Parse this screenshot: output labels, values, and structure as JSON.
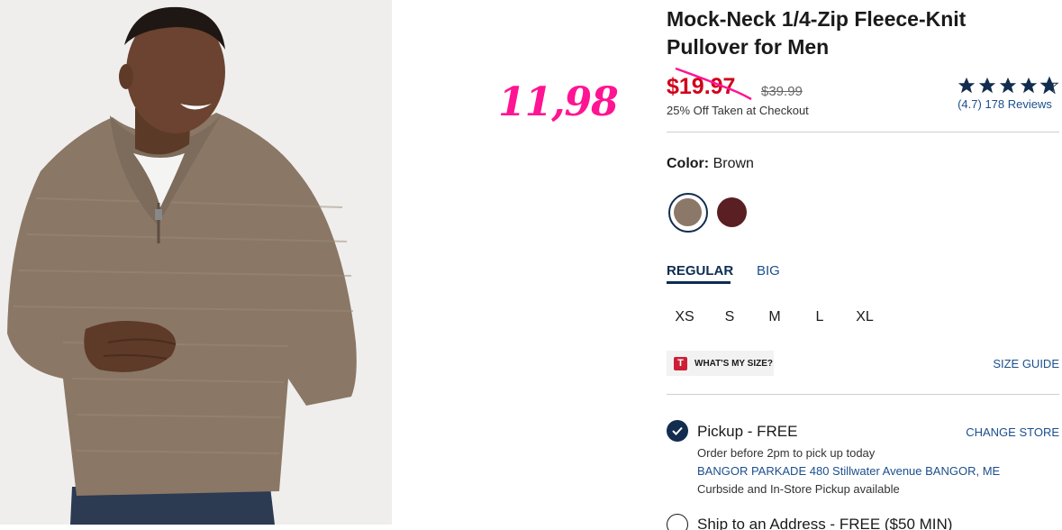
{
  "overlay": {
    "handwritten_price": "11,98"
  },
  "product": {
    "title": "Mock-Neck 1/4-Zip Fleece-Knit Pullover for Men",
    "sale_price": "$19.97",
    "original_price": "$39.99",
    "discount_note": "25% Off Taken at Checkout",
    "rating": {
      "stars": 4.7,
      "score_text": "(4.7)",
      "reviews_text": "178 Reviews"
    }
  },
  "color": {
    "label": "Color:",
    "selected": "Brown",
    "swatches": [
      {
        "name": "Brown",
        "hex": "#8b7868",
        "selected": true
      },
      {
        "name": "Burgundy",
        "hex": "#5a1f22",
        "selected": false
      }
    ]
  },
  "fit_tabs": [
    {
      "label": "REGULAR",
      "active": true
    },
    {
      "label": "BIG",
      "active": false
    }
  ],
  "sizes": [
    "XS",
    "S",
    "M",
    "L",
    "XL"
  ],
  "size_tools": {
    "whats_my_size": "WHAT'S MY SIZE?",
    "logo_letter": "T",
    "size_guide": "SIZE GUIDE"
  },
  "fulfillment": {
    "pickup": {
      "title": "Pickup - FREE",
      "change_store": "CHANGE STORE",
      "order_note": "Order before 2pm to pick up today",
      "store": "BANGOR PARKADE 480 Stillwater Avenue  BANGOR, ME",
      "curbside": "Curbside and In-Store Pickup available"
    },
    "ship": {
      "title": "Ship to an Address - FREE ($50 MIN)"
    }
  },
  "colors": {
    "accent_navy": "#122d4e",
    "link_blue": "#1b4f8c",
    "sale_red": "#d0021b",
    "overlay_pink": "#ff1493"
  }
}
